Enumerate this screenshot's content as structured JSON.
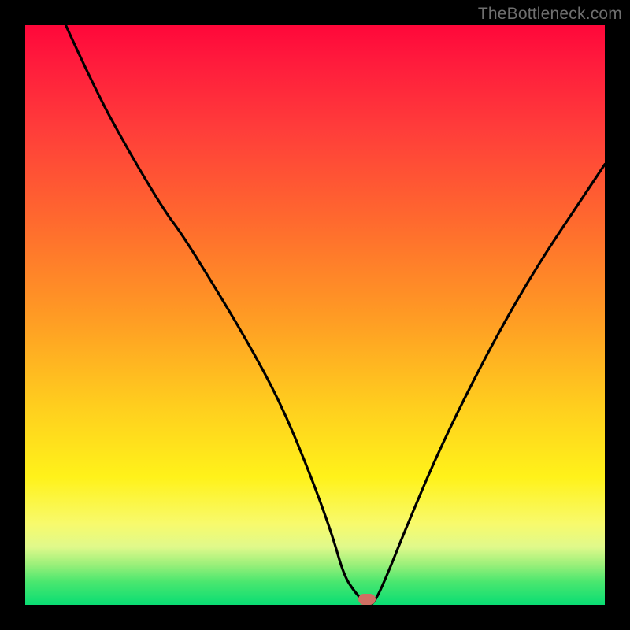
{
  "attribution": "TheBottleneck.com",
  "colors": {
    "frame": "#000000",
    "gradient_top": "#ff073a",
    "gradient_bottom": "#0add73",
    "curve": "#000000",
    "marker": "#cf6f63"
  },
  "chart_data": {
    "type": "line",
    "title": "",
    "xlabel": "",
    "ylabel": "",
    "xlim": [
      0,
      100
    ],
    "ylim": [
      0,
      100
    ],
    "grid": false,
    "legend": null,
    "series": [
      {
        "name": "bottleneck-curve",
        "x": [
          7,
          12,
          18,
          24,
          27,
          32,
          38,
          44,
          49,
          53,
          55,
          57,
          59,
          60,
          62,
          66,
          72,
          80,
          88,
          96,
          100
        ],
        "values": [
          100,
          89,
          78,
          68,
          64,
          56,
          46,
          35,
          23,
          12,
          5,
          2,
          0,
          0,
          4,
          14,
          28,
          44,
          58,
          70,
          76
        ]
      }
    ],
    "annotations": [
      {
        "name": "optimal-marker",
        "x": 59,
        "y": 1
      }
    ]
  }
}
